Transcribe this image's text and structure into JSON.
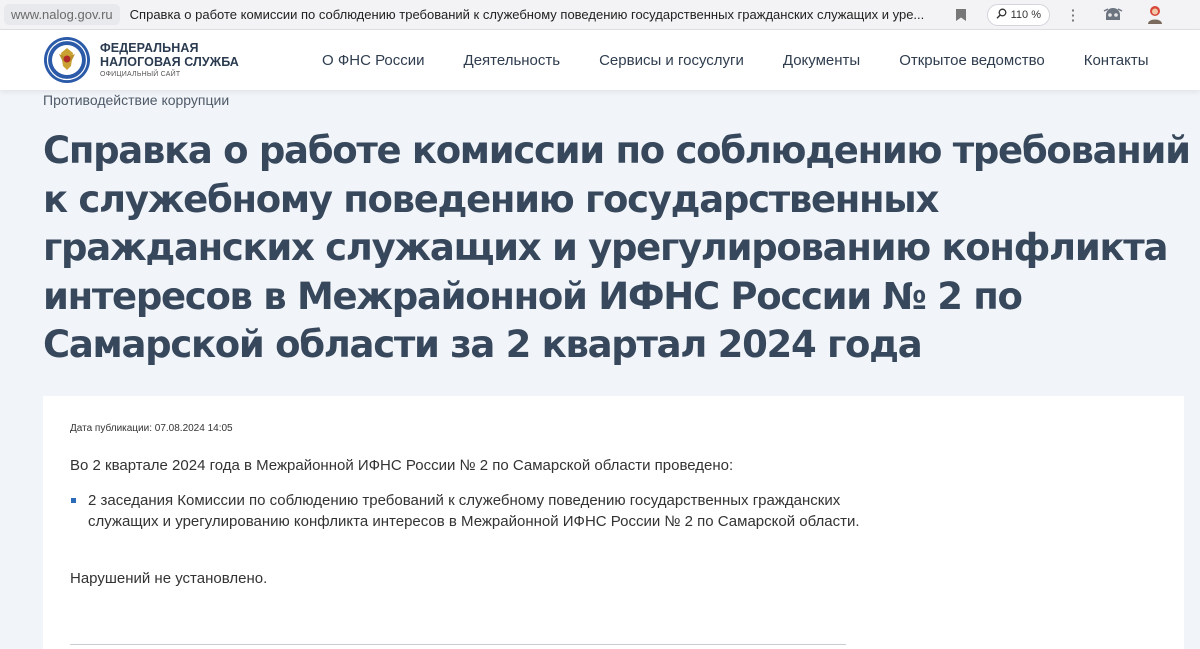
{
  "browser": {
    "host": "www.nalog.gov.ru",
    "page_title": "Справка о работе комиссии по соблюдению требований к служебному поведению государственных гражданских служащих и уре...",
    "zoom": "110 %"
  },
  "header": {
    "logo_line1": "ФЕДЕРАЛЬНАЯ",
    "logo_line2": "НАЛОГОВАЯ СЛУЖБА",
    "logo_sub": "ОФИЦИАЛЬНЫЙ САЙТ",
    "nav": [
      {
        "label": "О ФНС России"
      },
      {
        "label": "Деятельность"
      },
      {
        "label": "Сервисы и госуслуги"
      },
      {
        "label": "Документы"
      },
      {
        "label": "Открытое ведомство"
      },
      {
        "label": "Контакты"
      }
    ]
  },
  "breadcrumb": "Противодействие коррупции",
  "title": "Справка о работе комиссии по соблюдению требований к служебному поведению государственных гражданских служащих и урегулированию конфликта интересов в Межрайонной ИФНС России № 2 по Самарской области за 2 квартал 2024 года",
  "article": {
    "pub_date": "Дата публикации: 07.08.2024 14:05",
    "intro": "Во 2 квартале 2024 года в Межрайонной ИФНС России № 2 по Самарской области проведено:",
    "bullets": [
      "2 заседания Комиссии по соблюдению требований к служебному поведению государственных гражданских служащих и урегулированию конфликта интересов в Межрайонной ИФНС России № 2 по Самарской области."
    ],
    "conclusion": "Нарушений не установлено."
  },
  "colors": {
    "title": "#38485c",
    "bullet_accent": "#2c6bb7",
    "page_bg": "#f1f4f8"
  },
  "icons": [
    "bookmark-icon",
    "zoom-search-icon",
    "kebab-menu-icon",
    "extension-icon",
    "profile-icon",
    "fns-emblem-icon"
  ]
}
